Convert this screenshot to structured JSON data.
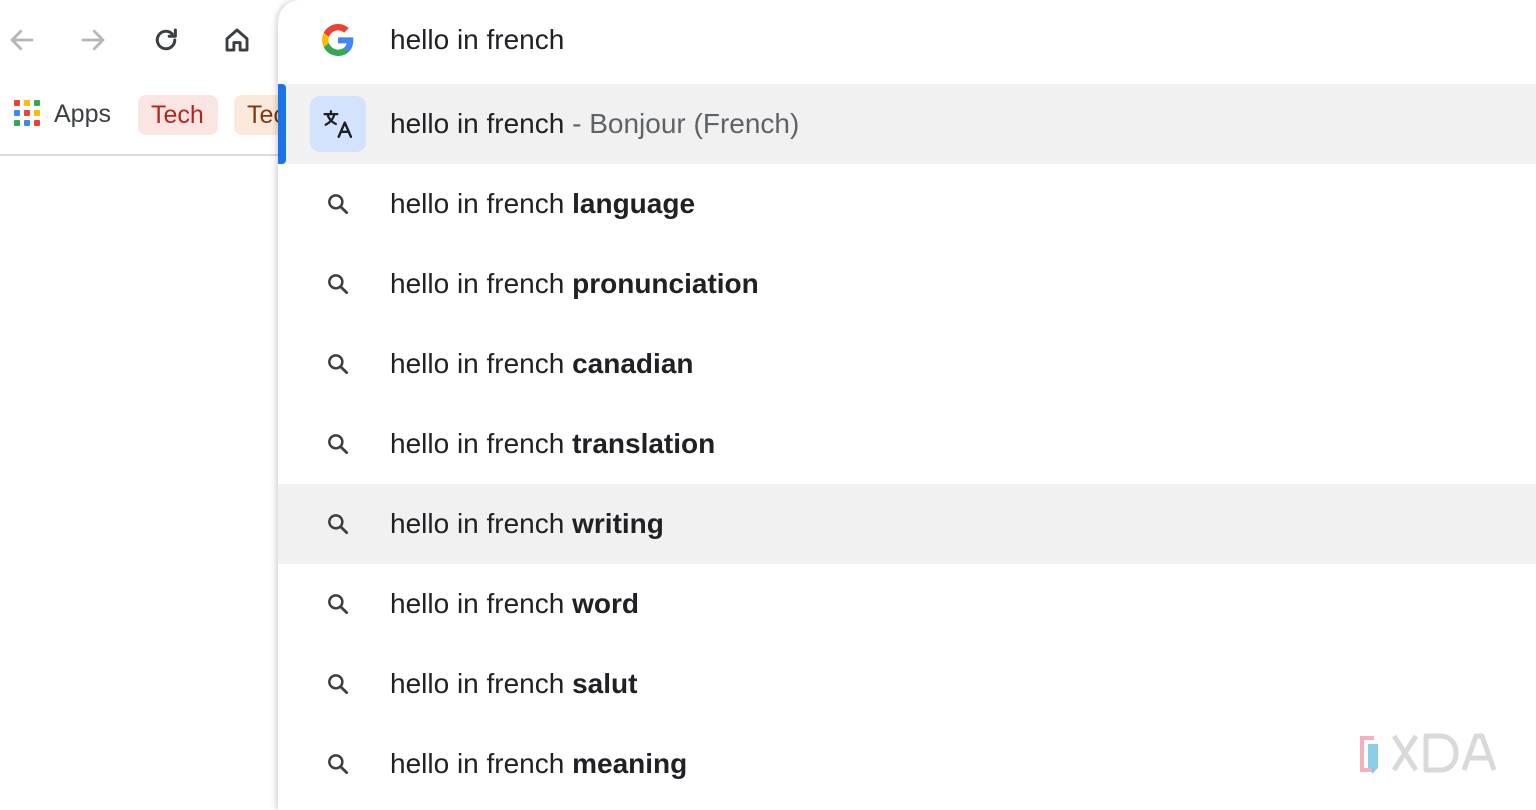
{
  "toolbar": {
    "back_icon": "arrow-left-icon",
    "forward_icon": "arrow-right-icon",
    "reload_icon": "reload-icon",
    "home_icon": "home-icon"
  },
  "bookmarks": {
    "apps_label": "Apps",
    "items": [
      {
        "label": "Tech",
        "color": "#b3261e",
        "bg": "#fbe5e3"
      },
      {
        "label": "Tec",
        "color": "#7a3b12",
        "bg": "#fbeadc"
      }
    ]
  },
  "omnibox": {
    "query": "hello in french",
    "answer": {
      "query": "hello in french",
      "separator": " - ",
      "translation": "Bonjour (French)",
      "icon": "translate-icon"
    },
    "suggestions": [
      {
        "prefix": "hello in french ",
        "completion": "language"
      },
      {
        "prefix": "hello in french ",
        "completion": "pronunciation"
      },
      {
        "prefix": "hello in french ",
        "completion": "canadian"
      },
      {
        "prefix": "hello in french ",
        "completion": "translation"
      },
      {
        "prefix": "hello in french ",
        "completion": "writing"
      },
      {
        "prefix": "hello in french ",
        "completion": "word"
      },
      {
        "prefix": "hello in french ",
        "completion": "salut"
      },
      {
        "prefix": "hello in french ",
        "completion": "meaning"
      }
    ],
    "selection_color": "#1a73e8"
  },
  "watermark": {
    "text": "XDA"
  }
}
